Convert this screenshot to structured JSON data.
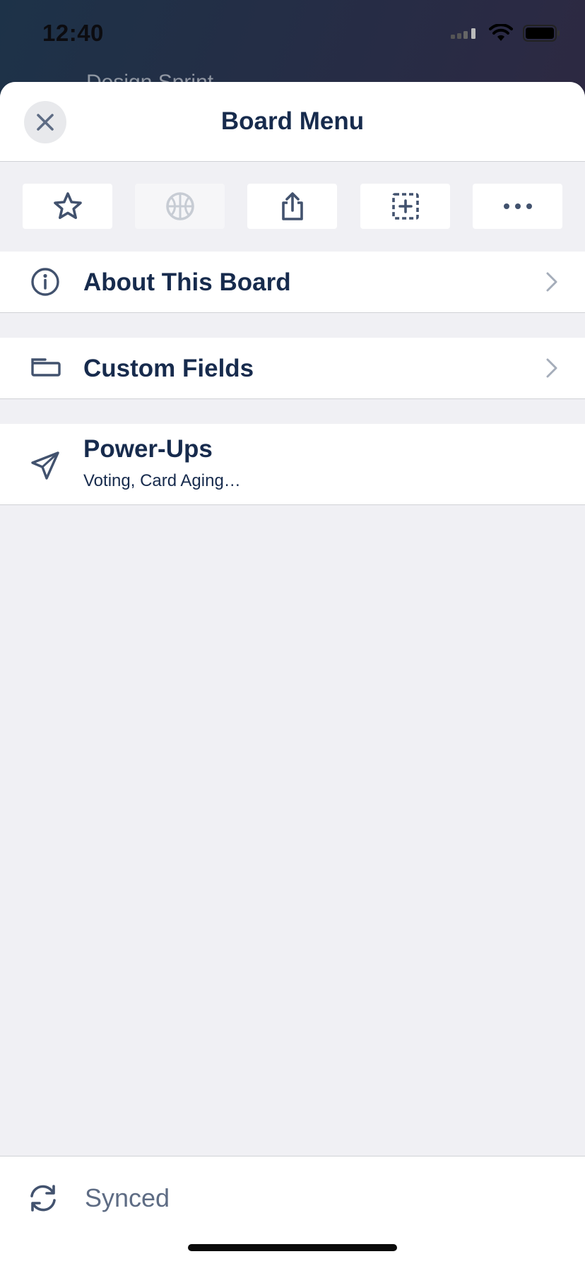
{
  "status_bar": {
    "time": "12:40"
  },
  "background_board_title": "Design Sprint",
  "sheet": {
    "title": "Board Menu",
    "close_icon": "close-icon"
  },
  "action_bar": [
    {
      "icon": "star-icon",
      "enabled": true
    },
    {
      "icon": "basketball-icon",
      "enabled": false
    },
    {
      "icon": "share-icon",
      "enabled": true
    },
    {
      "icon": "add-card-dashed-icon",
      "enabled": true
    },
    {
      "icon": "more-icon",
      "enabled": true
    }
  ],
  "menu": {
    "about": {
      "label": "About This Board",
      "icon": "info-icon"
    },
    "custom_fields": {
      "label": "Custom Fields",
      "icon": "custom-field-icon"
    },
    "power_ups": {
      "label": "Power-Ups",
      "subtitle": "Voting, Card Aging…",
      "icon": "rocket-icon"
    }
  },
  "footer": {
    "sync_status": "Synced",
    "icon": "sync-icon"
  },
  "colors": {
    "text_primary": "#172b4d",
    "text_secondary": "#5e6c84",
    "icon": "#42526e",
    "sheet_bg": "#f0f0f4"
  }
}
